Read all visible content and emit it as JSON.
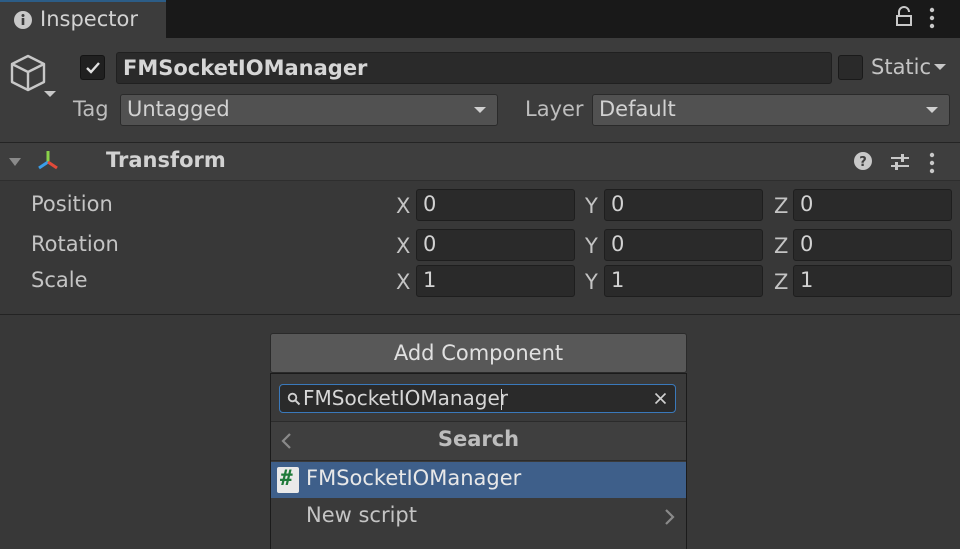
{
  "window": {
    "tab_title": "Inspector"
  },
  "gameobject": {
    "active": true,
    "name": "FMSocketIOManager",
    "static_label": "Static",
    "tag_label": "Tag",
    "tag_value": "Untagged",
    "layer_label": "Layer",
    "layer_value": "Default"
  },
  "transform": {
    "title": "Transform",
    "rows": [
      {
        "label": "Position",
        "x": "0",
        "y": "0",
        "z": "0"
      },
      {
        "label": "Rotation",
        "x": "0",
        "y": "0",
        "z": "0"
      },
      {
        "label": "Scale",
        "x": "1",
        "y": "1",
        "z": "1"
      }
    ],
    "axes": {
      "x": "X",
      "y": "Y",
      "z": "Z"
    }
  },
  "add_component": {
    "button_label": "Add Component",
    "search_value": "FMSocketIOManager",
    "header": "Search",
    "results": [
      {
        "label": "FMSocketIOManager",
        "icon_glyph": "#",
        "selected": true
      },
      {
        "label": "New script",
        "selected": false
      }
    ]
  },
  "colors": {
    "accent": "#3a79bb",
    "selection": "#3e5f8a",
    "background": "#383838"
  },
  "icons": [
    "info-icon",
    "lock-icon",
    "kebab-menu-icon",
    "cube-icon",
    "checkmark-icon",
    "foldout-icon",
    "transform-icon",
    "help-icon",
    "presets-icon",
    "search-icon",
    "clear-icon",
    "back-icon",
    "chevron-right-icon",
    "script-icon"
  ]
}
